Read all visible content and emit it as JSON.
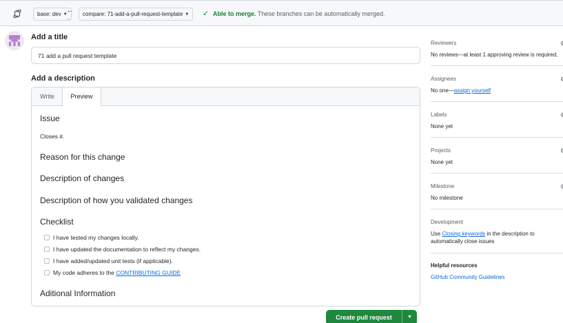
{
  "compare_bar": {
    "base_label": "base: dev",
    "compare_label": "compare: 71-add-a-pull-request-template",
    "merge_status_bold": "Able to merge.",
    "merge_status_text": "These branches can be automatically merged."
  },
  "form": {
    "title_heading": "Add a title",
    "title_value": "71 add a pull request template",
    "description_heading": "Add a description",
    "tabs": [
      "Write",
      "Preview"
    ],
    "active_tab": "Preview"
  },
  "preview": {
    "issue_heading": "Issue",
    "issue_text": "Closes #.",
    "reason_heading": "Reason for this change",
    "changes_heading": "Description of changes",
    "validation_heading": "Description of how you validated changes",
    "checklist_heading": "Checklist",
    "checklist": [
      {
        "text": "I have tested my changes locally.",
        "checked": false
      },
      {
        "text": "I have updated the documentation to reflect my changes.",
        "checked": false
      },
      {
        "text": "I have added/updated unit tests (if applicable).",
        "checked": false
      },
      {
        "text": "My code adheres to the ",
        "link": "CONTRIBUTING GUIDE",
        "checked": false
      }
    ],
    "additional_heading": "Aditional Information"
  },
  "actions": {
    "create_label": "Create pull request"
  },
  "sidebar": {
    "reviewers": {
      "label": "Reviewers",
      "value": "No reviews—at least 1 approving review is required."
    },
    "assignees": {
      "label": "Assignees",
      "value_prefix": "No one—",
      "value_link": "assign yourself"
    },
    "labels": {
      "label": "Labels",
      "value": "None yet"
    },
    "projects": {
      "label": "Projects",
      "value": "None yet"
    },
    "milestone": {
      "label": "Milestone",
      "value": "No milestone"
    },
    "development": {
      "label": "Development",
      "text_prefix": "Use ",
      "link": "Closing keywords",
      "text_suffix": " in the description to",
      "text_line2": "automatically close issues"
    },
    "helpful": {
      "label": "Helpful resources",
      "link": "GitHub Community Guidelines"
    }
  },
  "colors": {
    "accent_green": "#1f883d",
    "link_blue": "#0969da",
    "merge_green": "#1a7f37"
  },
  "icons": [
    "git-compare-icon",
    "arrow-left-icon",
    "check-icon",
    "caret-down-icon",
    "gear-icon",
    "avatar-identicon"
  ]
}
